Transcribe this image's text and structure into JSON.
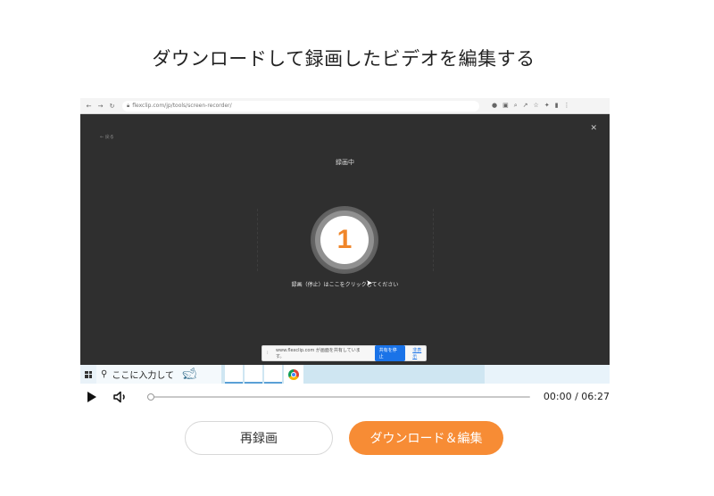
{
  "heading": "ダウンロードして録画したビデオを編集する",
  "video": {
    "browser": {
      "url": "flexclip.com/jp/tools/screen-recorder/"
    },
    "back_label": "← 戻る",
    "recording_label": "録画中",
    "countdown": "1",
    "stop_hint": "録画（停止）はここをクリックしてください",
    "share_bar": {
      "text": "www.flexclip.com が画面を共有しています。",
      "stop_label": "共有を停止",
      "hide_label": "非表示"
    },
    "taskbar": {
      "search_placeholder": "ここに入力して"
    }
  },
  "player": {
    "time": "00:00 / 06:27",
    "progress": 0
  },
  "buttons": {
    "rerecord": "再録画",
    "download_edit": "ダウンロード＆編集"
  },
  "colors": {
    "accent": "#f78c35",
    "countdown": "#f0862a"
  }
}
